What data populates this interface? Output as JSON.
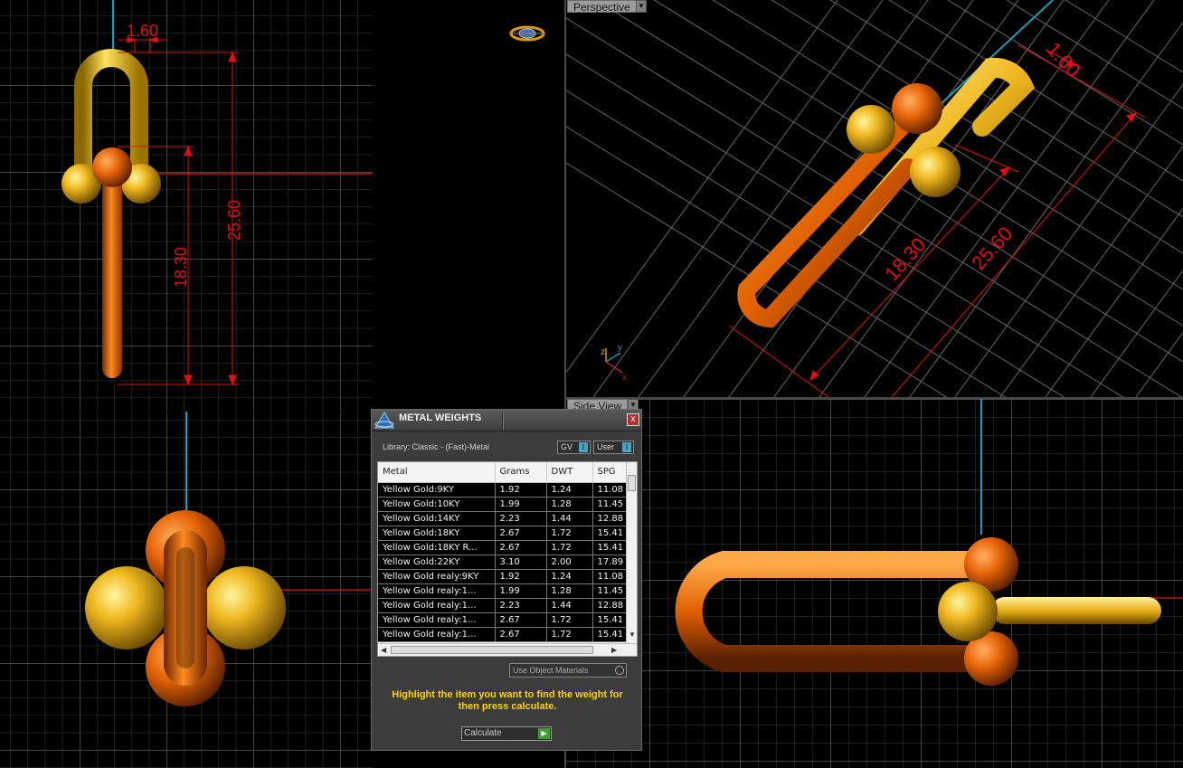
{
  "viewports": {
    "perspective_label": "Perspective",
    "side_label": "Side View"
  },
  "dimensions": {
    "width": "1.60",
    "inner_length": "18.30",
    "outer_length": "25.60"
  },
  "axis_gizmo": {
    "x": "x",
    "y": "y",
    "z": "z"
  },
  "panel": {
    "title": "METAL WEIGHTS",
    "close": "x",
    "library": "Library: Classic - (Fast)-Metal",
    "toggle_gv": "GV",
    "toggle_user": "User",
    "columns": [
      "Metal",
      "Grams",
      "DWT",
      "SPG"
    ],
    "rows": [
      [
        "Yellow Gold:9KY",
        "1.92",
        "1.24",
        "11.08"
      ],
      [
        "Yellow Gold:10KY",
        "1.99",
        "1.28",
        "11.45"
      ],
      [
        "Yellow Gold:14KY",
        "2.23",
        "1.44",
        "12.88"
      ],
      [
        "Yellow Gold:18KY",
        "2.67",
        "1.72",
        "15.41"
      ],
      [
        "Yellow Gold:18KY R...",
        "2.67",
        "1.72",
        "15.41"
      ],
      [
        "Yellow Gold:22KY",
        "3.10",
        "2.00",
        "17.89"
      ],
      [
        "Yellow Gold realy:9KY",
        "1.92",
        "1.24",
        "11.08"
      ],
      [
        "Yellow Gold realy:1...",
        "1.99",
        "1.28",
        "11.45"
      ],
      [
        "Yellow Gold realy:1...",
        "2.23",
        "1.44",
        "12.88"
      ],
      [
        "Yellow Gold realy:1...",
        "2.67",
        "1.72",
        "15.41"
      ],
      [
        "Yellow Gold realy:1...",
        "2.67",
        "1.72",
        "15.41"
      ]
    ],
    "use_object_materials": "Use Object Materials",
    "hint": "Highlight the item you want to find the weight for then press calculate.",
    "calculate": "Calculate"
  }
}
